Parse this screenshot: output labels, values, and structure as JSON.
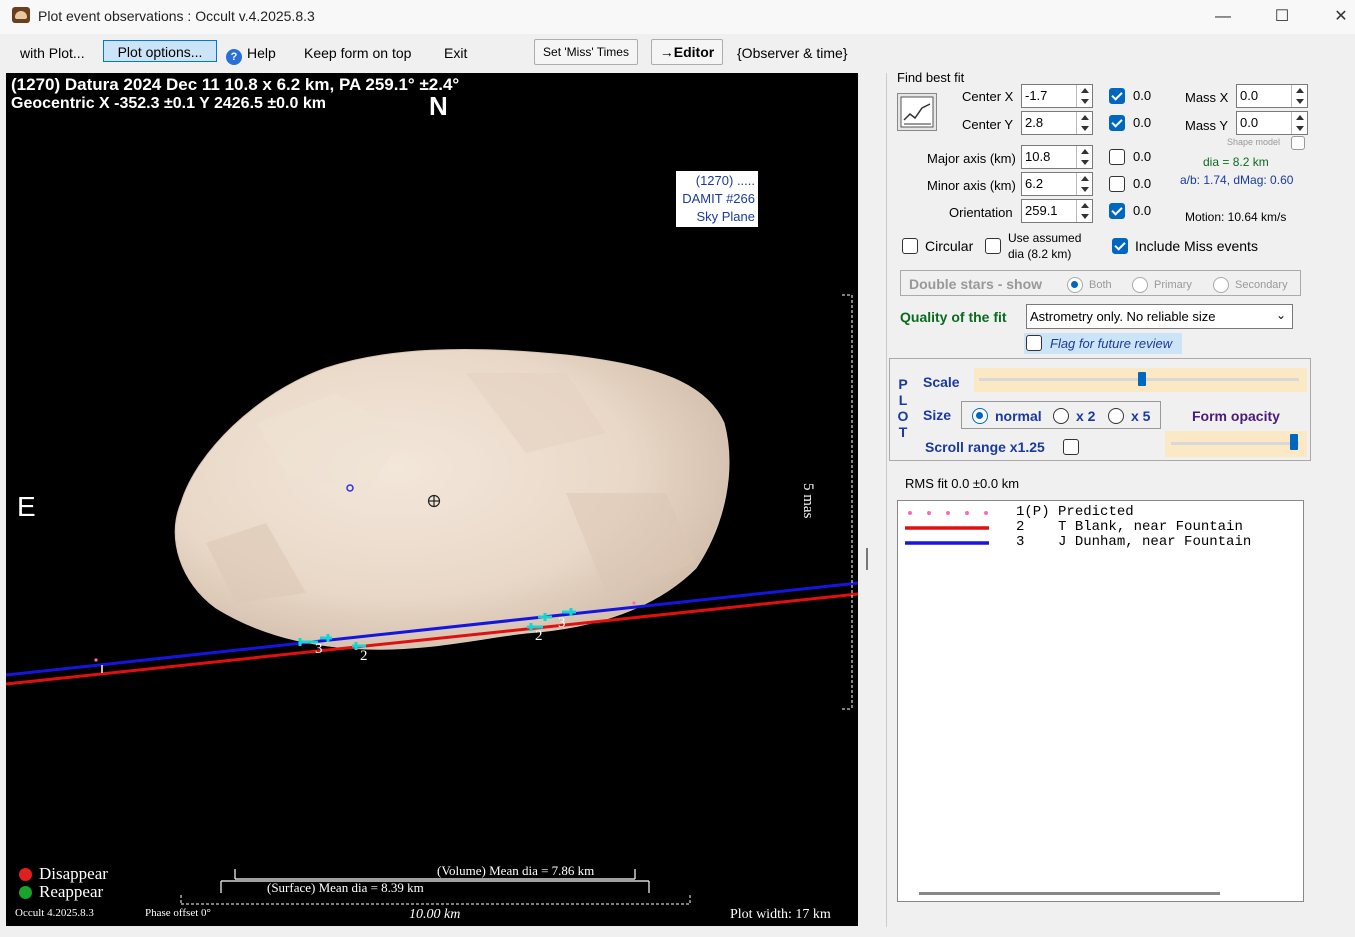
{
  "window": {
    "title": "Plot event observations : Occult v.4.2025.8.3"
  },
  "menu": {
    "with_plot": "with Plot...",
    "plot_options": "Plot options...",
    "help": "Help",
    "keep_on_top": "Keep form on top",
    "exit": "Exit",
    "set_miss_times": "Set 'Miss' Times",
    "editor": "→Editor",
    "observer_time": "{Observer & time}"
  },
  "plot": {
    "header_line1": "(1270) Datura  2024 Dec 11   10.8 x 6.2 km,  PA 259.1° ±2.4°",
    "header_line2": "Geocentric  X  -352.3 ±0.1   Y 2426.5 ±0.0 km",
    "north": "N",
    "east": "E",
    "sky_plane": [
      "(1270) .....",
      "DAMIT #266",
      "Sky Plane"
    ],
    "scale_mas": "5 mas",
    "chord_labels": [
      "3",
      "2",
      "2",
      "3",
      "1"
    ],
    "legend_disappear": "Disappear",
    "legend_reappear": "Reappear",
    "volume_dia": "(Volume) Mean dia = 7.86 km",
    "surface_dia": "(Surface) Mean dia = 8.39 km",
    "scale_km": "10.00 km",
    "version": "Occult 4.2025.8.3",
    "phase_offset": "Phase offset 0°",
    "plot_width": "Plot width: 17 km",
    "colors": {
      "disappear": "#e02020",
      "reappear": "#1aa32a",
      "chord_red": "#e01010",
      "chord_blue": "#1515e0",
      "marker": "#19d3d3"
    }
  },
  "fit": {
    "section_title": "Find best fit",
    "center_x_label": "Center X",
    "center_x": "-1.7",
    "center_x_fix": "0.0",
    "center_y_label": "Center Y",
    "center_y": "2.8",
    "center_y_fix": "0.0",
    "mass_x_label": "Mass X",
    "mass_x": "0.0",
    "mass_y_label": "Mass Y",
    "mass_y": "0.0",
    "shape_model": "Shape model",
    "major_label": "Major axis (km)",
    "major": "10.8",
    "major_fix": "0.0",
    "minor_label": "Minor axis (km)",
    "minor": "6.2",
    "minor_fix": "0.0",
    "orient_label": "Orientation",
    "orient": "259.1",
    "orient_fix": "0.0",
    "dia": "dia = 8.2 km",
    "ab": "a/b: 1.74, dMag: 0.60",
    "motion": "Motion: 10.64 km/s",
    "circular": "Circular",
    "use_assumed_1": "Use assumed",
    "use_assumed_2": "dia (8.2 km)",
    "include_miss": "Include Miss events",
    "double_stars": "Double stars - show",
    "both": "Both",
    "primary": "Primary",
    "secondary": "Secondary",
    "quality_label": "Quality of the fit",
    "quality_value": "Astrometry only. No reliable size",
    "flag_review": "Flag for future review"
  },
  "plotgroup": {
    "vertical": [
      "P",
      "L",
      "O",
      "T"
    ],
    "scale": "Scale",
    "size": "Size",
    "normal": "normal",
    "x2": "x 2",
    "x5": "x 5",
    "form_opacity": "Form opacity",
    "scroll_range": "Scroll range x1.25",
    "scale_level": 0.5,
    "opacity_level": 0.95
  },
  "rms": "RMS fit 0.0 ±0.0 km",
  "observers": [
    {
      "num": "1",
      "tag": "(P)",
      "name": "Predicted"
    },
    {
      "num": "2",
      "tag": "",
      "name": "T Blank, near Fountain"
    },
    {
      "num": "3",
      "tag": "",
      "name": "J Dunham, near Fountain"
    }
  ]
}
